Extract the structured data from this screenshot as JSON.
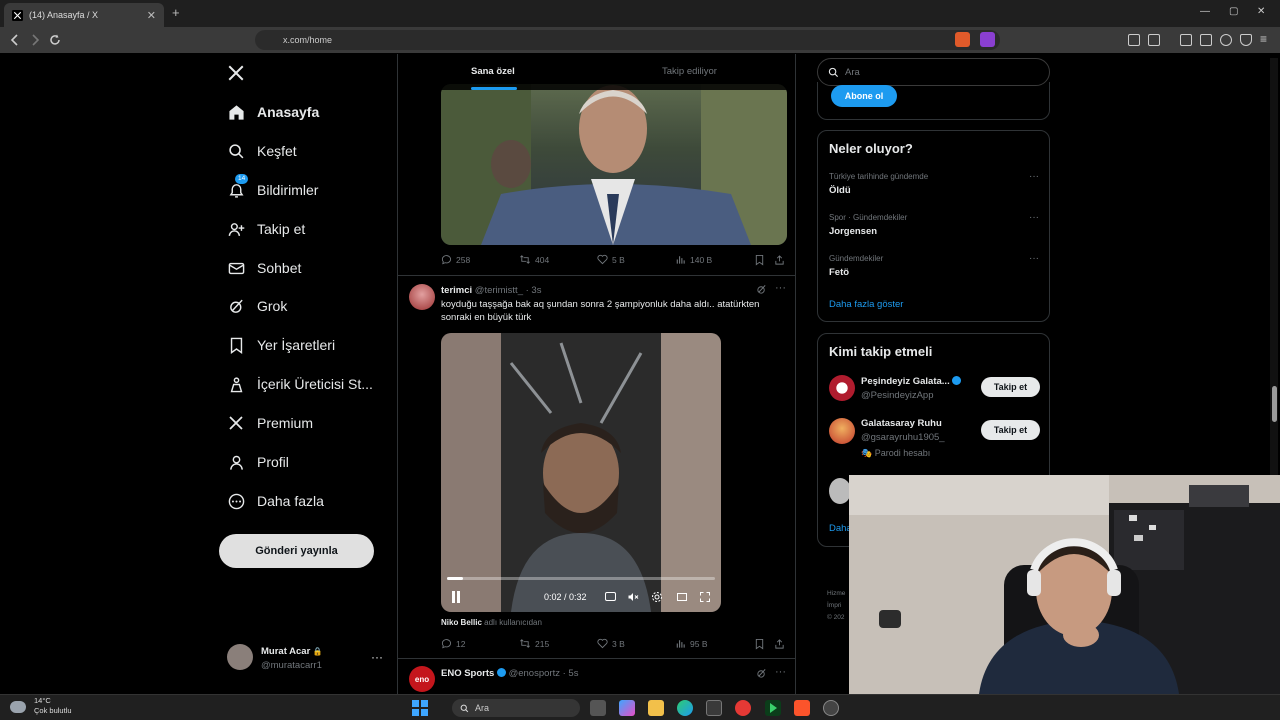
{
  "browser": {
    "tab_title": "(14) Anasayfa / X",
    "url": "x.com/home",
    "new_tab_symbol": "+",
    "tab_close_symbol": "✕"
  },
  "nav": {
    "items": [
      {
        "label": "Anasayfa",
        "icon": "home-icon"
      },
      {
        "label": "Keşfet",
        "icon": "search-icon"
      },
      {
        "label": "Bildirimler",
        "icon": "bell-icon",
        "badge": "14"
      },
      {
        "label": "Takip et",
        "icon": "add-user-icon"
      },
      {
        "label": "Sohbet",
        "icon": "mail-icon"
      },
      {
        "label": "Grok",
        "icon": "grok-icon"
      },
      {
        "label": "Yer İşaretleri",
        "icon": "bookmark-icon"
      },
      {
        "label": "İçerik Üreticisi St...",
        "icon": "creator-icon"
      },
      {
        "label": "Premium",
        "icon": "x-icon"
      },
      {
        "label": "Profil",
        "icon": "person-icon"
      },
      {
        "label": "Daha fazla",
        "icon": "more-circle-icon"
      }
    ],
    "post_button": "Gönderi yayınla",
    "profile": {
      "name": "Murat Acar",
      "handle": "@muratacarr1",
      "more": "···"
    }
  },
  "feed": {
    "tabs": [
      "Sana özel",
      "Takip ediliyor"
    ],
    "tweet1_stats": {
      "replies": "258",
      "retweets": "404",
      "likes": "5 B",
      "views": "140 B"
    },
    "tweet2": {
      "name": "terimci",
      "handle": "@terimistt_",
      "time": "· 3s",
      "text": "koyduğu taşşağa bak aq şundan sonra 2 şampiyonluk daha aldı.. atatürkten sonraki en büyük türk",
      "video_time": "0:02 / 0:32",
      "video_progress": 0.06,
      "credit_name": "Niko Bellic",
      "credit_suffix": "adlı kullanıcıdan",
      "stats": {
        "replies": "12",
        "retweets": "215",
        "likes": "3 B",
        "views": "95 B"
      }
    },
    "tweet3": {
      "name": "ENO Sports",
      "handle": "@enosportz",
      "time": "· 5s",
      "avatar_text": "eno"
    }
  },
  "sidebar": {
    "search_placeholder": "Ara",
    "subscribe_button": "Abone ol",
    "trends_title": "Neler oluyor?",
    "trends": [
      {
        "meta": "Türkiye tarihinde gündemde",
        "name": "Öldü"
      },
      {
        "meta": "Spor · Gündemdekiler",
        "name": "Jorgensen"
      },
      {
        "meta": "Gündemdekiler",
        "name": "Fetö"
      }
    ],
    "show_more": "Daha fazla göster",
    "who_to_follow_title": "Kimi takip etmeli",
    "follow_suggestions": [
      {
        "name": "Peşindeyiz Galata...",
        "handle": "@PesindeyizApp",
        "button": "Takip et",
        "verified": true
      },
      {
        "name": "Galatasaray Ruhu",
        "handle": "@gsarayruhu1905_",
        "button": "Takip et",
        "note": "🎭 Parodi hesabı"
      }
    ],
    "show_more_partial": "Daha",
    "footer_partial": [
      "Hizme",
      "İmpri",
      "© 202"
    ]
  },
  "taskbar": {
    "weather_temp": "14°C",
    "weather_desc": "Çok bulutlu",
    "search_placeholder": "Ara"
  },
  "colors": {
    "accent": "#1d9bf0",
    "bg": "#000000",
    "border": "#2f3336",
    "muted": "#71767b"
  }
}
